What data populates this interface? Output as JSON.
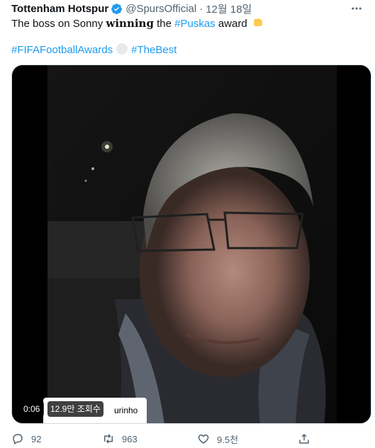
{
  "tweet": {
    "author_name": "Tottenham Hotspur",
    "handle": "@SpursOfficial",
    "separator": "·",
    "date": "12월 18일",
    "text_prefix": "The boss on Sonny ",
    "text_bold": "winning",
    "text_mid": " the ",
    "text_hashtag": "#Puskas",
    "text_suffix": " award",
    "hashtags": [
      "#FIFAFootballAwards",
      "#TheBest"
    ]
  },
  "video": {
    "elapsed": "0:06",
    "views": "12.9만 조회수",
    "caption_fragment": "urinho"
  },
  "actions": {
    "replies": "92",
    "retweets": "963",
    "likes": "9.5천"
  },
  "colors": {
    "accent": "#1d9bf0",
    "muted": "#536471",
    "text": "#0f1419"
  },
  "icons": {
    "verified": "verified-badge-icon",
    "more": "more-icon",
    "emoji": "fist-emoji-icon",
    "reply": "reply-icon",
    "retweet": "retweet-icon",
    "like": "heart-icon",
    "share": "share-icon"
  }
}
